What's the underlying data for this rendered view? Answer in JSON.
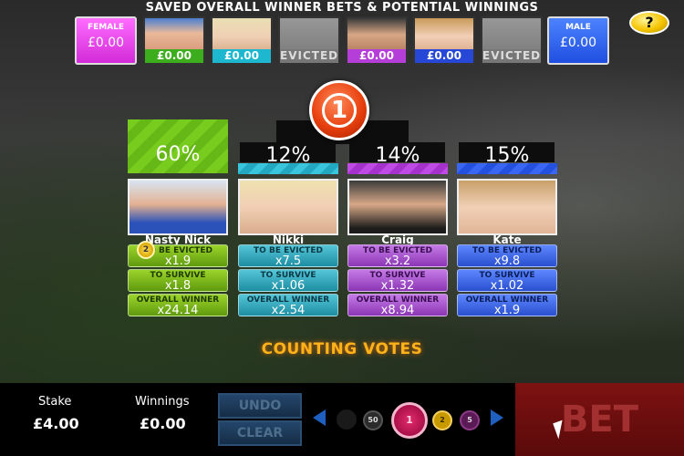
{
  "header": {
    "title": "SAVED OVERALL WINNER BETS & POTENTIAL WINNINGS",
    "help_label": "?"
  },
  "topbar": {
    "female": {
      "label": "FEMALE",
      "amount": "£0.00"
    },
    "male": {
      "label": "MALE",
      "amount": "£0.00"
    },
    "tiles": [
      {
        "value": "£0.00",
        "status_color": "#3cae1e"
      },
      {
        "value": "£0.00",
        "status_color": "#1db7cf"
      },
      {
        "value": "EVICTED",
        "status_color": "#777777"
      },
      {
        "value": "£0.00",
        "status_color": "#b53ed8"
      },
      {
        "value": "£0.00",
        "status_color": "#2747d6"
      },
      {
        "value": "EVICTED",
        "status_color": "#777777"
      }
    ]
  },
  "timer": {
    "value": "1"
  },
  "contestants": [
    {
      "name": "Nasty Nick",
      "percent": "60%",
      "color": "#6cc21c",
      "odds": [
        {
          "label": "TO BE EVICTED",
          "value": "x1.9"
        },
        {
          "label": "TO SURVIVE",
          "value": "x1.8"
        },
        {
          "label": "OVERALL WINNER",
          "value": "x24.14"
        }
      ]
    },
    {
      "name": "Nikki",
      "percent": "12%",
      "color": "#2ab9d2",
      "odds": [
        {
          "label": "TO BE EVICTED",
          "value": "x7.5"
        },
        {
          "label": "TO SURVIVE",
          "value": "x1.06"
        },
        {
          "label": "OVERALL WINNER",
          "value": "x2.54"
        }
      ]
    },
    {
      "name": "Craig",
      "percent": "14%",
      "color": "#b43bdf",
      "odds": [
        {
          "label": "TO BE EVICTED",
          "value": "x3.2"
        },
        {
          "label": "TO SURVIVE",
          "value": "x1.32"
        },
        {
          "label": "OVERALL WINNER",
          "value": "x8.94"
        }
      ]
    },
    {
      "name": "Kate",
      "percent": "15%",
      "color": "#2d5cf0",
      "odds": [
        {
          "label": "TO BE EVICTED",
          "value": "x9.8"
        },
        {
          "label": "TO SURVIVE",
          "value": "x1.02"
        },
        {
          "label": "OVERALL WINNER",
          "value": "x1.9"
        }
      ]
    }
  ],
  "placed_chip": {
    "value": "2"
  },
  "status": {
    "text": "COUNTING VOTES"
  },
  "footer": {
    "stake_label": "Stake",
    "stake_value": "£4.00",
    "winnings_label": "Winnings",
    "winnings_value": "£0.00",
    "undo_label": "UNDO",
    "clear_label": "CLEAR",
    "bet_label": "BET",
    "chips": [
      {
        "value": "",
        "color": "#1a1a1a"
      },
      {
        "value": "50",
        "color": "#2b2b2b"
      },
      {
        "value": "1",
        "color": "#c2185b"
      },
      {
        "value": "2",
        "color": "#c99a00"
      },
      {
        "value": "5",
        "color": "#5a1a55"
      }
    ]
  }
}
